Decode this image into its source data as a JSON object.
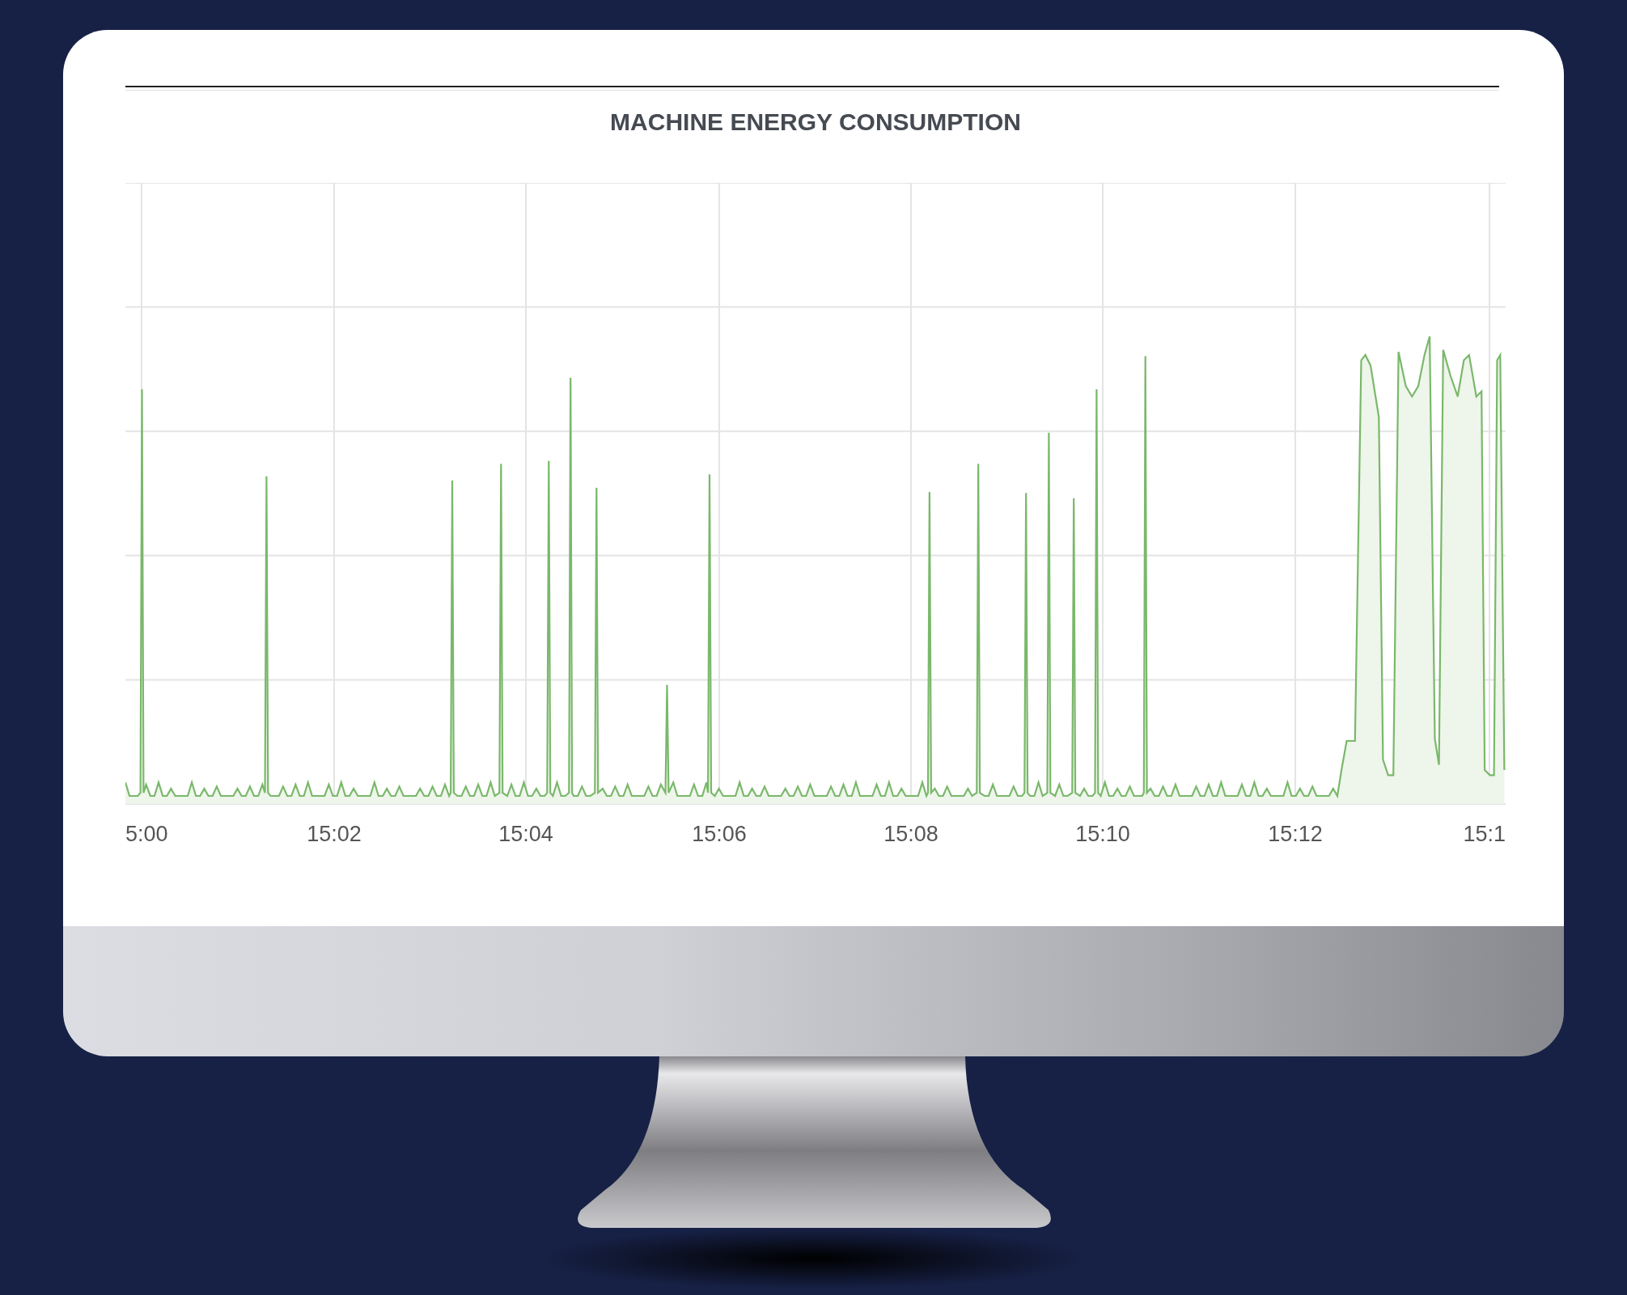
{
  "chart": {
    "title": "MACHINE ENERGY CONSUMPTION",
    "x_labels": [
      "5:00",
      "15:02",
      "15:04",
      "15:06",
      "15:08",
      "15:10",
      "15:12",
      "15:1"
    ]
  }
}
